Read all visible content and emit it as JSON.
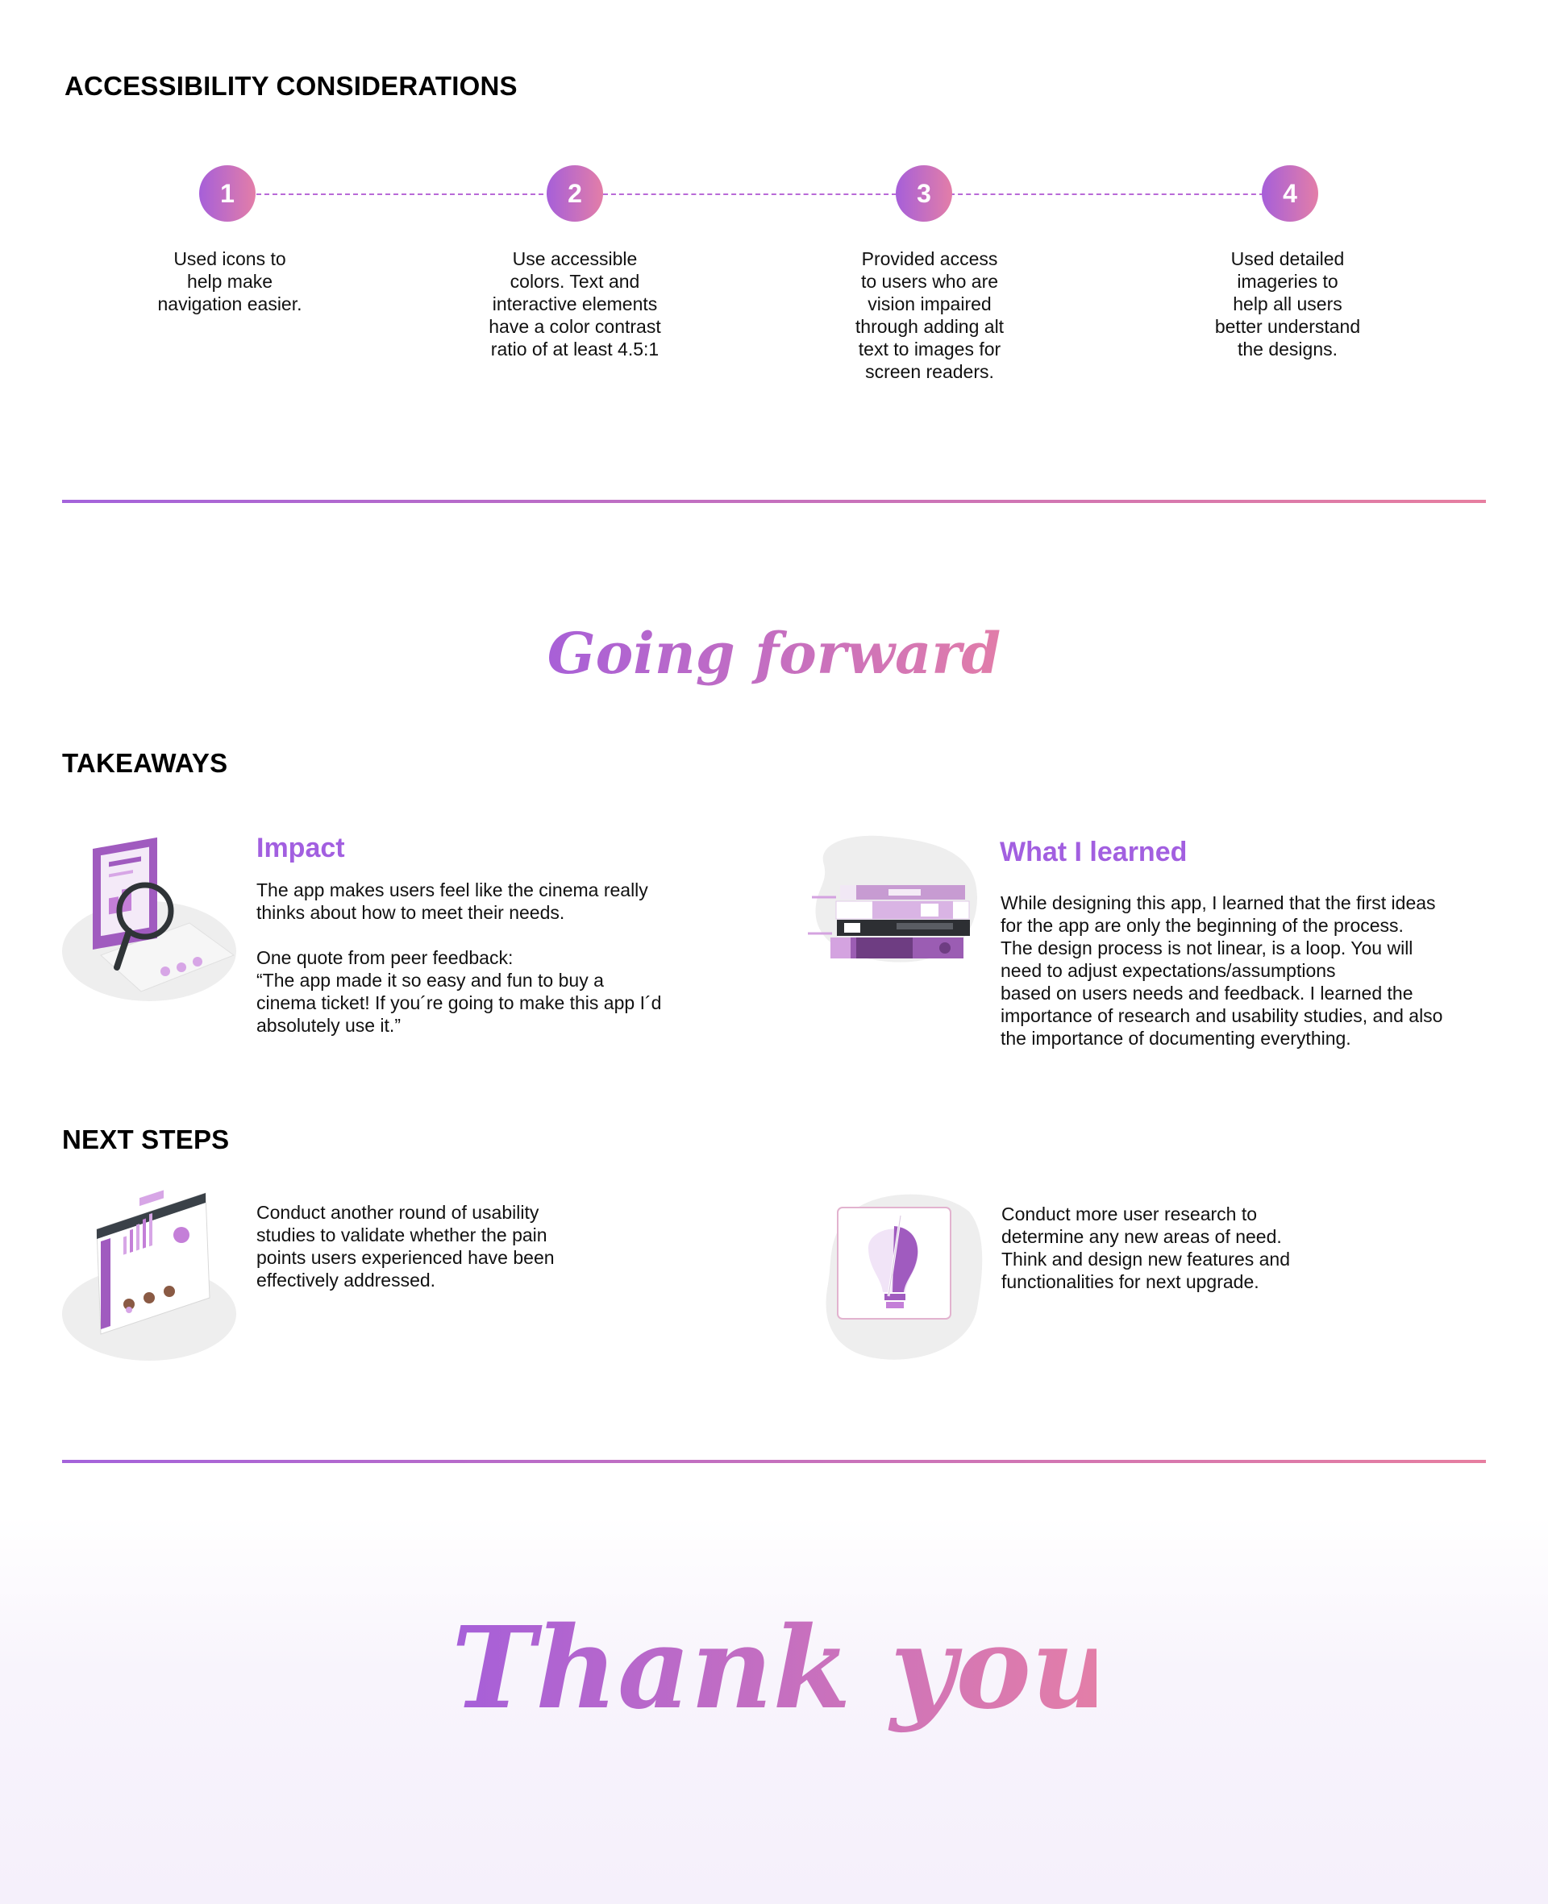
{
  "accessibility": {
    "heading": "ACCESSIBILITY CONSIDERATIONS",
    "steps": [
      {
        "number": "1",
        "text": "Used icons to\nhelp make\nnavigation easier."
      },
      {
        "number": "2",
        "text": "Use accessible\ncolors. Text and\ninteractive elements\nhave a color contrast\nratio of at least 4.5:1"
      },
      {
        "number": "3",
        "text": "Provided access\n to users who are\nvision impaired\nthrough adding alt\ntext to images for\nscreen readers."
      },
      {
        "number": "4",
        "text": "Used detailed\nimageries to\nhelp all users\nbetter understand\n the designs."
      }
    ]
  },
  "going_forward": {
    "title": "Going forward"
  },
  "takeaways": {
    "heading": "TAKEAWAYS",
    "impact": {
      "title": "Impact",
      "text": "The app makes users feel like the cinema really\nthinks about how to meet their needs.\n\nOne quote from peer feedback:\n“The app made it so easy and fun to buy a\ncinema ticket! If you´re going to make this app I´d\nabsolutely use it.”",
      "icon": "analysis-magnifier-illustration"
    },
    "learned": {
      "title": "What I learned",
      "text": "While designing this app, I learned that the first ideas\nfor the app are only the beginning of the process.\nThe design process is not linear, is a loop. You will\nneed to adjust expectations/assumptions\nbased on users needs and feedback. I learned the\nimportance of research and usability studies, and also\nthe importance of documenting everything.",
      "icon": "book-stack-illustration"
    }
  },
  "next_steps": {
    "heading": "NEXT STEPS",
    "usability": {
      "text": "Conduct another round of usability\nstudies to validate whether the pain\npoints users experienced have been\neffectively addressed.",
      "icon": "dashboard-illustration"
    },
    "research": {
      "text": "Conduct more user research to\ndetermine any new areas of need.\nThink and design new features and\nfunctionalities for next upgrade.",
      "icon": "lightbulb-illustration"
    }
  },
  "footer": {
    "title": "Thank you!"
  },
  "colors": {
    "accent_purple": "#a65fd9",
    "accent_pink": "#e37ea8",
    "title_purple": "#a25fe0"
  }
}
